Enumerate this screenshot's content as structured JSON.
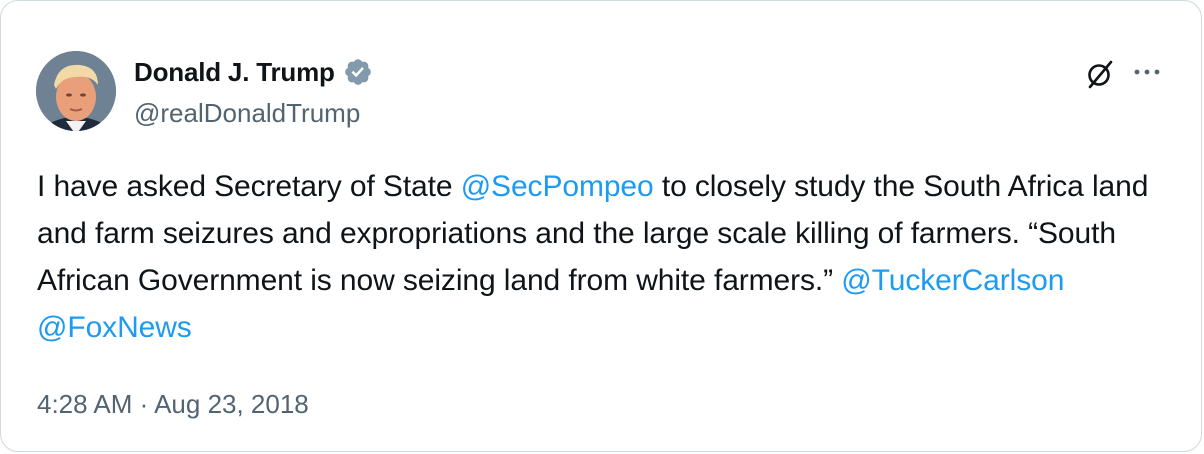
{
  "author": {
    "display_name": "Donald J. Trump",
    "handle": "@realDonaldTrump",
    "verified_color": "#829aab"
  },
  "actions": {
    "grok_icon": "grok-icon",
    "more_icon": "more-horizontal-icon"
  },
  "tweet": {
    "parts": [
      {
        "text": "I have asked Secretary of State ",
        "mention": false
      },
      {
        "text": "@SecPompeo",
        "mention": true
      },
      {
        "text": " to closely study the South Africa land and farm seizures and expropriations and the large scale killing of farmers. “South African Government is now seizing land from white farmers.” ",
        "mention": false
      },
      {
        "text": "@TuckerCarlson",
        "mention": true
      },
      {
        "text": " ",
        "mention": false
      },
      {
        "text": "@FoxNews",
        "mention": true
      }
    ]
  },
  "meta": {
    "time": "4:28 AM",
    "separator": " · ",
    "date": "Aug 23, 2018"
  },
  "colors": {
    "link": "#1d9bf0",
    "text": "#0f1419",
    "secondary": "#536471",
    "border": "#cfd9de"
  }
}
